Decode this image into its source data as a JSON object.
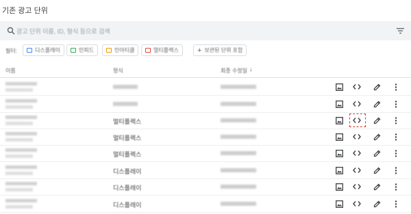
{
  "page": {
    "title": "기존 광고 단위"
  },
  "search": {
    "placeholder": "광고 단위 이름, ID, 형식 등으로 검색"
  },
  "filters": {
    "label": "필터:",
    "chips": [
      {
        "label": "디스플레이",
        "color": "#4285f4"
      },
      {
        "label": "인피드",
        "color": "#34a853"
      },
      {
        "label": "인아티클",
        "color": "#f29900"
      },
      {
        "label": "멀티플렉스",
        "color": "#ea4335"
      }
    ],
    "add_label": "보관된 단위 포함"
  },
  "table": {
    "headers": {
      "name": "이름",
      "type": "형식",
      "modified": "최종 수정일"
    },
    "rows": [
      {
        "type": ""
      },
      {
        "type": ""
      },
      {
        "type": "멀티플렉스"
      },
      {
        "type": "멀티플렉스"
      },
      {
        "type": "멀티플렉스"
      },
      {
        "type": "디스플레이"
      },
      {
        "type": "디스플레이"
      },
      {
        "type": "디스플레이"
      }
    ]
  },
  "icons": {
    "search": "search-icon",
    "filter": "filter-list-icon",
    "image": "image-icon",
    "code": "code-icon",
    "edit": "pencil-icon",
    "more": "more-vert-icon"
  },
  "colors": {
    "highlight": "#d93025",
    "searchbar": "#f1f3f4"
  }
}
